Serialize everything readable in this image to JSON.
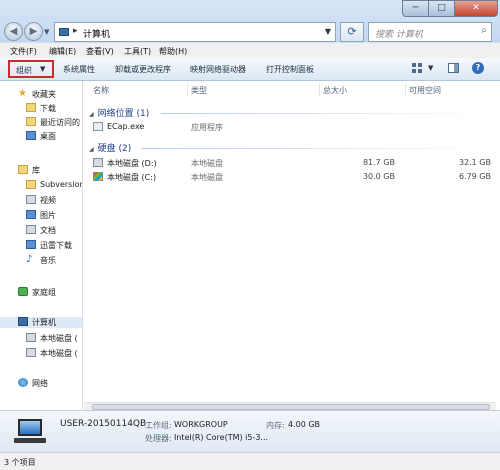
{
  "address": {
    "path": "计算机",
    "separator": "▸"
  },
  "search": {
    "placeholder": "搜索 计算机"
  },
  "window_controls": {
    "minimize": "─",
    "maximize": "□",
    "close": "✕"
  },
  "menu": {
    "items": [
      "文件(F)",
      "编辑(E)",
      "查看(V)",
      "工具(T)",
      "帮助(H)"
    ]
  },
  "commands": {
    "organize": "组织",
    "items": [
      "系统属性",
      "卸载或更改程序",
      "映射网络驱动器",
      "打开控制面板"
    ]
  },
  "nav": {
    "favorites": {
      "label": "收藏夹",
      "items": [
        "下载",
        "最近访问的",
        "桌面"
      ]
    },
    "libraries": {
      "label": "库",
      "items": [
        "Subversion",
        "视频",
        "图片",
        "文档",
        "迅雷下载",
        "音乐"
      ]
    },
    "homegroup": "家庭组",
    "computer": {
      "label": "计算机",
      "items": [
        "本地磁盘 (",
        "本地磁盘 ("
      ]
    },
    "network": "网络"
  },
  "columns": {
    "name": "名称",
    "type": "类型",
    "total": "总大小",
    "free": "可用空间"
  },
  "groups": {
    "network_location": {
      "label": "网络位置 (1)",
      "items": [
        {
          "name": "ECap.exe",
          "type": "应用程序"
        }
      ]
    },
    "hard_disks": {
      "label": "硬盘 (2)",
      "items": [
        {
          "name": "本地磁盘 (D:)",
          "type": "本地磁盘",
          "total": "81.7 GB",
          "free": "32.1 GB"
        },
        {
          "name": "本地磁盘 (C:)",
          "type": "本地磁盘",
          "total": "30.0 GB",
          "free": "6.79 GB"
        }
      ]
    }
  },
  "details": {
    "name": "USER-20150114QB",
    "workgroup_label": "工作组:",
    "workgroup": "WORKGROUP",
    "memory_label": "内存:",
    "memory": "4.00 GB",
    "processor_label": "处理器:",
    "processor": "Intel(R) Core(TM) i5-3..."
  },
  "status": {
    "text": "3 个项目"
  },
  "colors": {
    "organize_highlight": "#d12a2a",
    "group_header": "#1e3f8f"
  }
}
